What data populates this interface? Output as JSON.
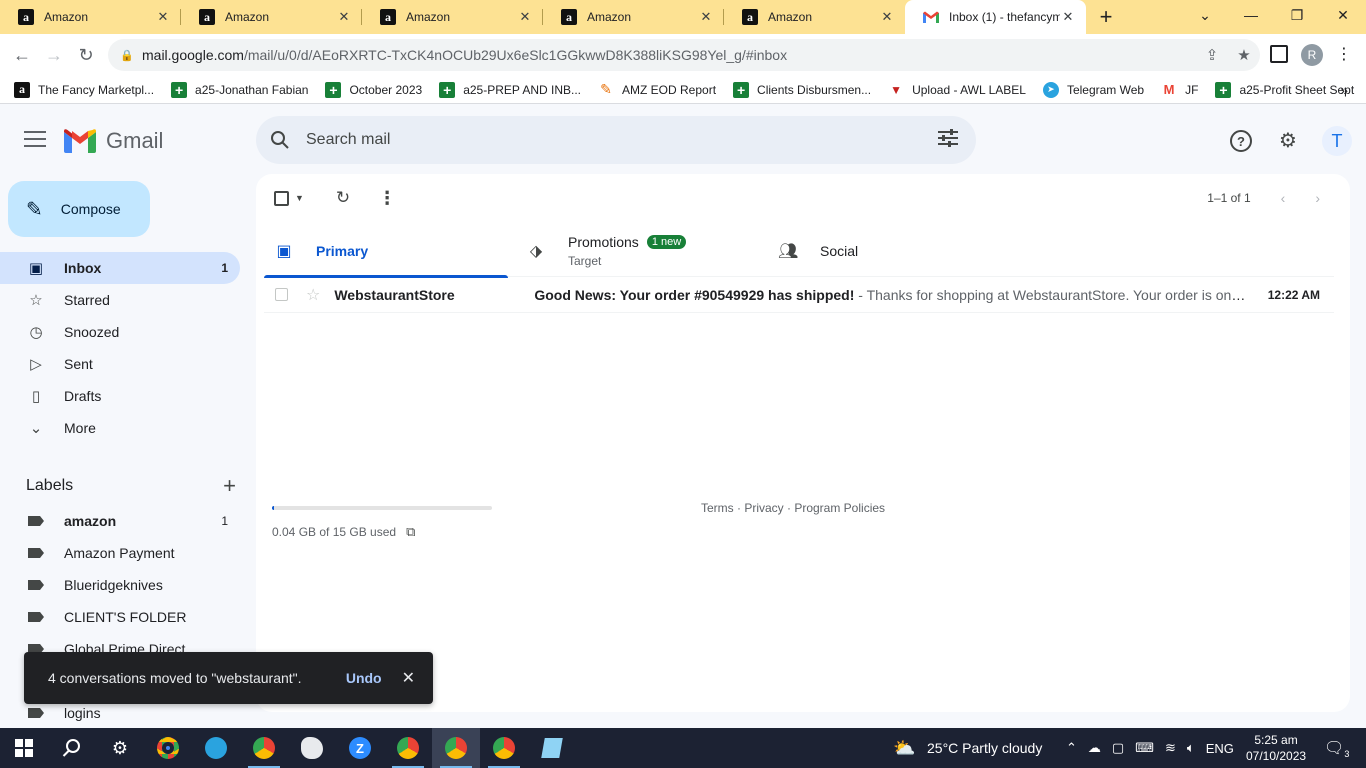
{
  "browser": {
    "tabs": [
      {
        "title": "Amazon",
        "favicon": "amazon-icon"
      },
      {
        "title": "Amazon",
        "favicon": "amazon-icon"
      },
      {
        "title": "Amazon",
        "favicon": "amazon-icon"
      },
      {
        "title": "Amazon",
        "favicon": "amazon-icon"
      },
      {
        "title": "Amazon",
        "favicon": "amazon-icon"
      },
      {
        "title": "Inbox (1) - thefancym",
        "favicon": "gmail-icon"
      }
    ],
    "url_host": "mail.google.com",
    "url_path": "/mail/u/0/d/AEoRXRTC-TxCK4nOCUb29Ux6eSlc1GGkwwD8K388liKSG98Yel_g/#inbox",
    "profile_initial": "R",
    "bookmarks": [
      {
        "label": "The Fancy Marketpl...",
        "icon": "amazon-icon"
      },
      {
        "label": "a25-Jonathan Fabian",
        "icon": "sheets-icon"
      },
      {
        "label": "October 2023",
        "icon": "sheets-icon"
      },
      {
        "label": "a25-PREP AND INB...",
        "icon": "sheets-icon"
      },
      {
        "label": "AMZ EOD Report",
        "icon": "pencil-icon"
      },
      {
        "label": "Clients Disbursmen...",
        "icon": "sheets-icon"
      },
      {
        "label": "Upload - AWL LABEL",
        "icon": "upload-icon"
      },
      {
        "label": "Telegram Web",
        "icon": "telegram-icon"
      },
      {
        "label": "JF",
        "icon": "gmail-icon"
      },
      {
        "label": "a25-Profit Sheet Sept",
        "icon": "sheets-icon"
      }
    ]
  },
  "gmail": {
    "brand": "Gmail",
    "search_placeholder": "Search mail",
    "account_initial": "T",
    "compose_label": "Compose",
    "nav": [
      {
        "label": "Inbox",
        "count": "1",
        "icon": "inbox-icon",
        "active": true
      },
      {
        "label": "Starred",
        "count": "",
        "icon": "star-icon"
      },
      {
        "label": "Snoozed",
        "count": "",
        "icon": "clock-icon"
      },
      {
        "label": "Sent",
        "count": "",
        "icon": "send-icon"
      },
      {
        "label": "Drafts",
        "count": "",
        "icon": "draft-icon"
      },
      {
        "label": "More",
        "count": "",
        "icon": "chevron-down-icon"
      }
    ],
    "labels_title": "Labels",
    "labels": [
      {
        "label": "amazon",
        "count": "1",
        "bold": true
      },
      {
        "label": "Amazon Payment",
        "count": ""
      },
      {
        "label": "Blueridgeknives",
        "count": ""
      },
      {
        "label": "CLIENT'S FOLDER",
        "count": ""
      },
      {
        "label": "Global Prime Direct",
        "count": ""
      },
      {
        "label": "",
        "count": ""
      },
      {
        "label": "logins",
        "count": ""
      }
    ],
    "pager_text": "1–1 of 1",
    "tabs": {
      "primary": "Primary",
      "promotions": "Promotions",
      "promotions_badge": "1 new",
      "promotions_sub": "Target",
      "social": "Social"
    },
    "emails": [
      {
        "sender": "WebstaurantStore",
        "subject": "Good News: Your order #90549929 has shipped!",
        "snippet": " - Thanks for shopping at WebstaurantStore. Your order is on its way.",
        "time": "12:22 AM"
      }
    ],
    "storage_text": "0.04 GB of 15 GB used",
    "storage_fraction": 0.003,
    "footer": "Terms · Privacy · Program Policies",
    "snackbar_msg": "4 conversations moved to \"webstaurant\".",
    "snackbar_action": "Undo"
  },
  "taskbar": {
    "weather": "25°C  Partly cloudy",
    "lang": "ENG",
    "time": "5:25 am",
    "date": "07/10/2023",
    "notifications": "3"
  }
}
